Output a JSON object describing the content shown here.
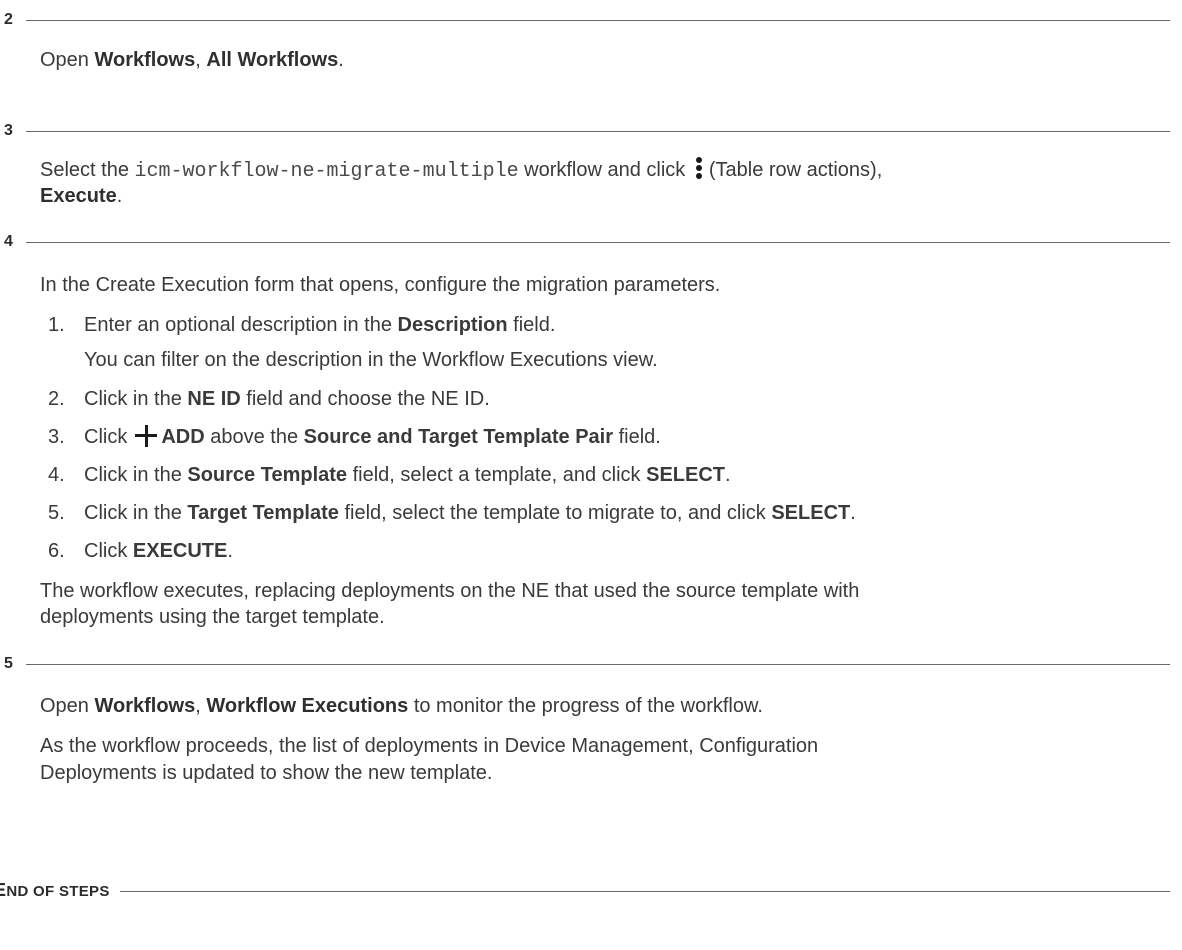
{
  "steps": [
    {
      "number": "2"
    },
    {
      "number": "3"
    },
    {
      "number": "4"
    },
    {
      "number": "5"
    }
  ],
  "step2": {
    "t1": "Open ",
    "b1": "Workflows",
    "t2": ", ",
    "b2": "All Workflows",
    "t3": "."
  },
  "step3": {
    "t1": "Select the ",
    "code": "icm-workflow-ne-migrate-multiple",
    "t2": " workflow and click ",
    "t3": "(Table row actions),",
    "b1": "Execute",
    "t4": "."
  },
  "step4": {
    "intro": "In the Create Execution form that opens, configure the migration parameters.",
    "items": [
      {
        "n": "1.",
        "t1": "Enter an optional description in the ",
        "b1": "Description",
        "t2": " field."
      },
      {
        "n": "2.",
        "t1": "Click in the ",
        "b1": "NE ID",
        "t2": " field and choose the NE ID."
      },
      {
        "n": "3.",
        "t1": "Click",
        "b1": "ADD",
        "t2": " above the ",
        "b2": "Source and Target Template Pair",
        "t3": " field."
      },
      {
        "n": "4.",
        "t1": "Click in the ",
        "b1": "Source Template",
        "t2": " field, select a template, and click ",
        "b2": "SELECT",
        "t3": "."
      },
      {
        "n": "5.",
        "t1": "Click in the ",
        "b1": "Target Template",
        "t2": " field, select the template to migrate to, and click ",
        "b2": "SELECT",
        "t3": "."
      },
      {
        "n": "6.",
        "t1": "Click ",
        "b1": "EXECUTE",
        "t2": "."
      }
    ],
    "sub1": "You can filter on the description in the Workflow Executions view.",
    "result_line1": "The workflow executes, replacing deployments on the NE that used the source template with",
    "result_line2": "deployments using the target template."
  },
  "step5": {
    "t1": "Open ",
    "b1": "Workflows",
    "t2": ", ",
    "b2": "Workflow Executions",
    "t3": " to monitor the progress of the workflow.",
    "line2": "As the workflow proceeds, the list of deployments in Device Management, Configuration",
    "line3": "Deployments is updated to show the new template."
  },
  "end": {
    "first": "E",
    "rest": "ND OF STEPS"
  },
  "icons": {
    "row_actions": "kebab-icon",
    "add": "plus-icon"
  }
}
